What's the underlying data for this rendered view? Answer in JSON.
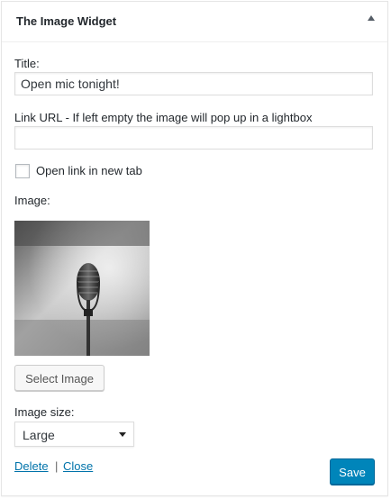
{
  "widget": {
    "title": "The Image Widget"
  },
  "form": {
    "title_label": "Title:",
    "title_value": "Open mic tonight!",
    "link_label": "Link URL - If left empty the image will pop up in a lightbox",
    "link_value": "",
    "checkbox_label": "Open link in new tab",
    "checkbox_checked": false,
    "image_label": "Image:",
    "image_description": "microphone-photo",
    "select_image_label": "Select Image",
    "size_label": "Image size:",
    "size_selected": "Large"
  },
  "actions": {
    "delete_label": "Delete",
    "separator": "|",
    "close_label": "Close",
    "save_label": "Save"
  },
  "colors": {
    "primary": "#0085ba",
    "link": "#0073aa"
  }
}
